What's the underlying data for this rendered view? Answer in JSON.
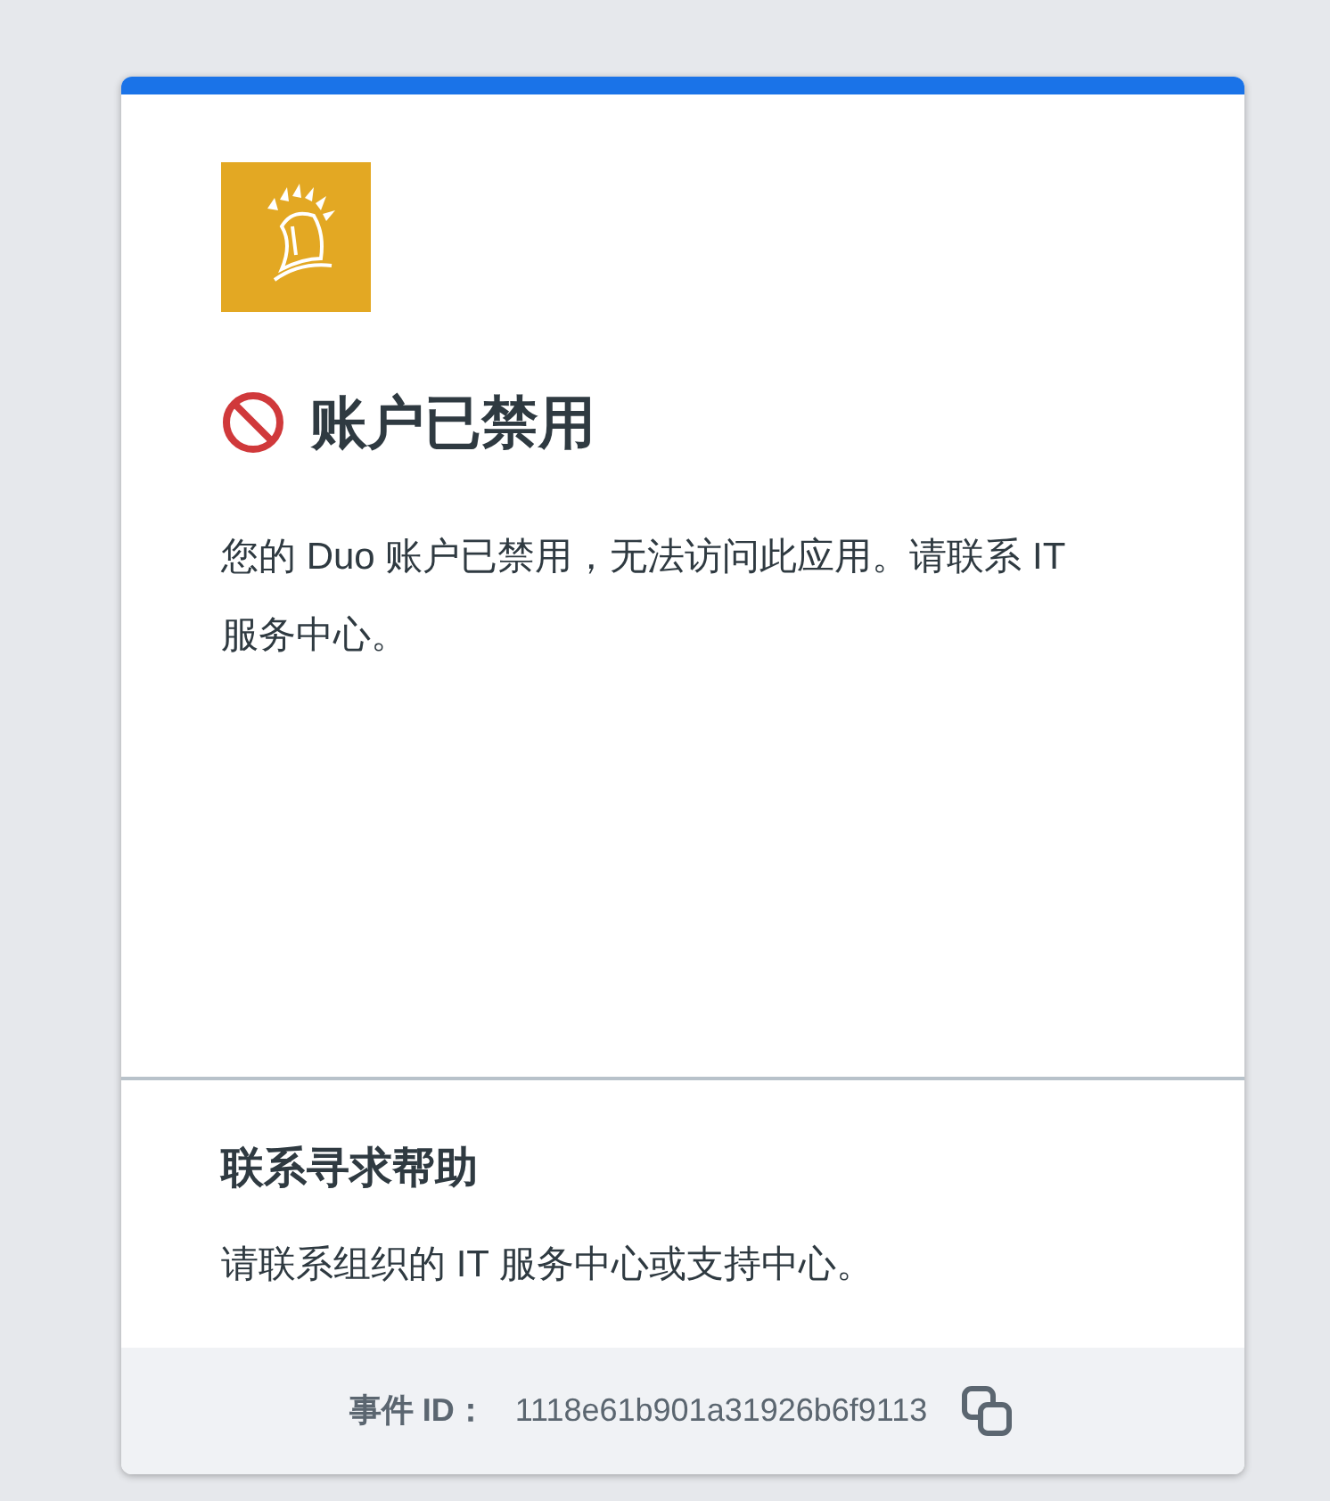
{
  "title": "账户已禁用",
  "message": "您的 Duo 账户已禁用，无法访问此应用。请联系 IT 服务中心。",
  "help": {
    "heading": "联系寻求帮助",
    "text": "请联系组织的 IT 服务中心或支持中心。"
  },
  "footer": {
    "label": "事件 ID：",
    "event_id": "1118e61b901a31926b6f9113"
  }
}
